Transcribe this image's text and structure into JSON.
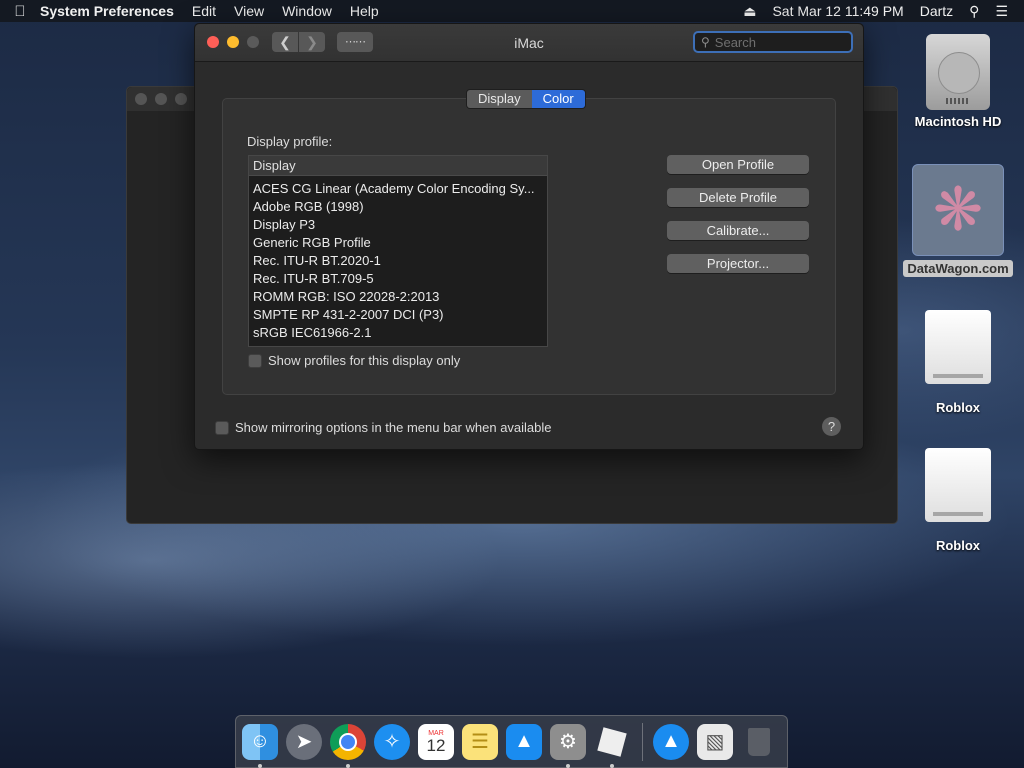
{
  "menubar": {
    "app_name": "System Preferences",
    "menus": [
      "Edit",
      "View",
      "Window",
      "Help"
    ],
    "clock": "Sat Mar 12  11:49 PM",
    "user": "Dartz"
  },
  "window": {
    "title": "iMac",
    "search_placeholder": "Search",
    "tabs": [
      "Display",
      "Color"
    ],
    "active_tab": "Color",
    "profile_label": "Display profile:",
    "list_header": "Display",
    "profiles": [
      "ACES CG Linear (Academy Color Encoding Sy...",
      "Adobe RGB (1998)",
      "Display P3",
      "Generic RGB Profile",
      "Rec. ITU-R BT.2020-1",
      "Rec. ITU-R BT.709-5",
      "ROMM RGB: ISO 22028-2:2013",
      "SMPTE RP 431-2-2007 DCI (P3)",
      "sRGB IEC61966-2.1"
    ],
    "buttons": {
      "open": "Open Profile",
      "delete": "Delete Profile",
      "calibrate": "Calibrate...",
      "projector": "Projector..."
    },
    "show_profiles_checkbox": "Show profiles for this display only",
    "mirroring_checkbox": "Show mirroring options in the menu bar when available",
    "help": "?"
  },
  "desktop": {
    "icons": [
      "Macintosh HD",
      "DataWagon.com",
      "Roblox",
      "Roblox"
    ]
  },
  "dock": {
    "calendar_month": "MAR",
    "calendar_day": "12"
  },
  "colors": {
    "accent": "#2d6bd8",
    "close": "#fe5f57",
    "minimize": "#febc2e"
  }
}
